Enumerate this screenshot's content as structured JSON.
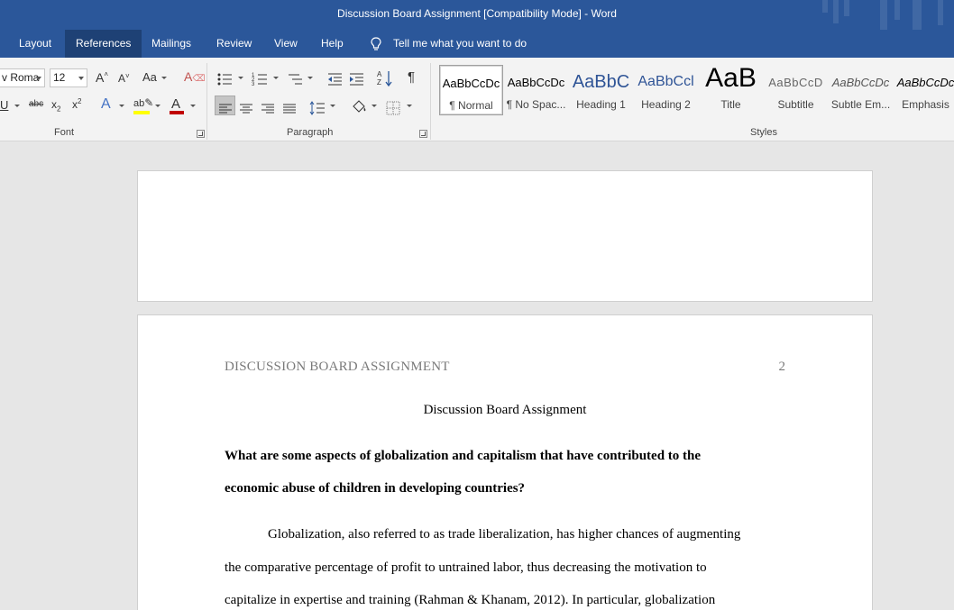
{
  "window": {
    "title": "Discussion Board Assignment [Compatibility Mode]  -  Word"
  },
  "menu": {
    "tabs": [
      {
        "label": "Layout",
        "active": false
      },
      {
        "label": "References",
        "active": true
      },
      {
        "label": "Mailings",
        "active": false
      },
      {
        "label": "Review",
        "active": false
      },
      {
        "label": "View",
        "active": false
      },
      {
        "label": "Help",
        "active": false
      }
    ],
    "tell_me": "Tell me what you want to do"
  },
  "ribbon": {
    "font": {
      "font_name": "v Roma",
      "font_size": "12",
      "change_case": "Aa",
      "group_label": "Font"
    },
    "paragraph": {
      "group_label": "Paragraph"
    },
    "styles": {
      "group_label": "Styles",
      "items": [
        {
          "sample": "AaBbCcDc",
          "name": "¶ Normal",
          "selected": true
        },
        {
          "sample": "AaBbCcDc",
          "name": "¶ No Spac...",
          "selected": false
        },
        {
          "sample": "AaBbC",
          "name": "Heading 1",
          "selected": false
        },
        {
          "sample": "AaBbCcl",
          "name": "Heading 2",
          "selected": false
        },
        {
          "sample": "AaB",
          "name": "Title",
          "selected": false
        },
        {
          "sample": "AaBbCcD",
          "name": "Subtitle",
          "selected": false
        },
        {
          "sample": "AaBbCcDc",
          "name": "Subtle Em...",
          "selected": false
        },
        {
          "sample": "AaBbCcDc",
          "name": "Emphasis",
          "selected": false
        }
      ]
    }
  },
  "document": {
    "running_header": "DISCUSSION BOARD ASSIGNMENT",
    "page_number": "2",
    "title": "Discussion Board Assignment",
    "question_lines": [
      "What are some aspects of globalization and capitalism that have contributed to the",
      "economic abuse of children in developing countries?"
    ],
    "body_lines": [
      "Globalization, also referred to as trade liberalization, has higher chances of augmenting",
      "the comparative percentage of profit to untrained labor, thus decreasing the motivation to",
      "capitalize in expertise and training (Rahman & Khanam, 2012). In particular, globalization"
    ]
  },
  "colors": {
    "title_bar": "#2b579a",
    "active_tab": "#1e4175",
    "ribbon_bg": "#f3f3f3",
    "doc_bg": "#e6e6e6",
    "header_text": "#7a7a7a",
    "font_color_swatch": "#c00000",
    "highlight_swatch": "#ffff00"
  }
}
